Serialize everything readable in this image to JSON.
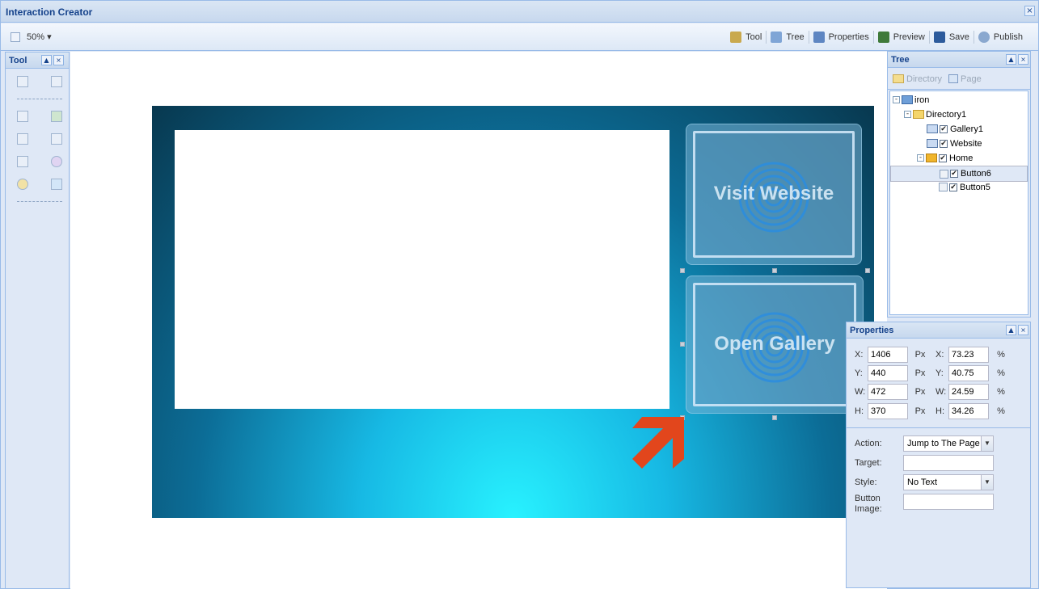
{
  "window": {
    "title": "Interaction Creator",
    "close_glyph": "×"
  },
  "toolbar": {
    "zoom_label": "50% ▾",
    "items": [
      {
        "label": "Tool",
        "icon": "tool-icon",
        "color": "#c9a94e"
      },
      {
        "label": "Tree",
        "icon": "tree-icon",
        "color": "#7fa5d6"
      },
      {
        "label": "Properties",
        "icon": "properties-icon",
        "color": "#5e86c2"
      },
      {
        "label": "Preview",
        "icon": "preview-icon",
        "color": "#3f7a3a"
      },
      {
        "label": "Save",
        "icon": "save-icon",
        "color": "#2d5b9c"
      },
      {
        "label": "Publish",
        "icon": "publish-icon",
        "color": "#8aa8cf"
      }
    ]
  },
  "tool_panel": {
    "title": "Tool",
    "collapse_glyph": "▲",
    "close_glyph": "×"
  },
  "stage": {
    "buttons": [
      {
        "label": "Visit Website"
      },
      {
        "label": "Open Gallery"
      }
    ],
    "arrow_color": "#e2461c"
  },
  "tree_panel": {
    "title": "Tree",
    "collapse_glyph": "▲",
    "close_glyph": "×",
    "toolbar": {
      "directory_label": "Directory",
      "page_label": "Page"
    },
    "nodes": [
      {
        "label": "iron"
      },
      {
        "label": "Directory1"
      },
      {
        "label": "Gallery1"
      },
      {
        "label": "Website"
      },
      {
        "label": "Home"
      },
      {
        "label": "Button6"
      },
      {
        "label": "Button5"
      }
    ],
    "expand_glyph": "-",
    "check_glyph": "✔"
  },
  "properties_panel": {
    "title": "Properties",
    "collapse_glyph": "▲",
    "close_glyph": "×",
    "px": {
      "x": {
        "label": "X:",
        "value": "1406",
        "unit": "Px"
      },
      "y": {
        "label": "Y:",
        "value": "440",
        "unit": "Px"
      },
      "w": {
        "label": "W:",
        "value": "472",
        "unit": "Px"
      },
      "h": {
        "label": "H:",
        "value": "370",
        "unit": "Px"
      }
    },
    "pct": {
      "x": {
        "label": "X:",
        "value": "73.23",
        "unit": "%"
      },
      "y": {
        "label": "Y:",
        "value": "40.75",
        "unit": "%"
      },
      "w": {
        "label": "W:",
        "value": "24.59",
        "unit": "%"
      },
      "h": {
        "label": "H:",
        "value": "34.26",
        "unit": "%"
      }
    },
    "action_label": "Action:",
    "action_value": "Jump to The Page",
    "target_label": "Target:",
    "target_value": "",
    "style_label": "Style:",
    "style_value": "No Text",
    "button_image_label": "Button Image:",
    "button_image_value": "",
    "dropdown_glyph": "▼"
  }
}
